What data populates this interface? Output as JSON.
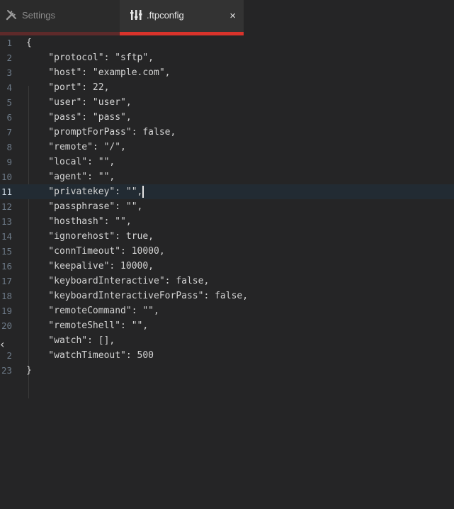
{
  "tabs": [
    {
      "label": "Settings",
      "icon": "tools-icon",
      "active": false
    },
    {
      "label": ".ftpconfig",
      "icon": "sliders-icon",
      "active": true,
      "close": "×"
    }
  ],
  "editor": {
    "current_line": 11,
    "lines": [
      {
        "num": "1",
        "text": "{"
      },
      {
        "num": "2",
        "text": "    \"protocol\": \"sftp\","
      },
      {
        "num": "3",
        "text": "    \"host\": \"example.com\","
      },
      {
        "num": "4",
        "text": "    \"port\": 22,"
      },
      {
        "num": "5",
        "text": "    \"user\": \"user\","
      },
      {
        "num": "6",
        "text": "    \"pass\": \"pass\","
      },
      {
        "num": "7",
        "text": "    \"promptForPass\": false,"
      },
      {
        "num": "8",
        "text": "    \"remote\": \"/\","
      },
      {
        "num": "9",
        "text": "    \"local\": \"\","
      },
      {
        "num": "10",
        "text": "    \"agent\": \"\","
      },
      {
        "num": "11",
        "text": "    \"privatekey\": \"\","
      },
      {
        "num": "12",
        "text": "    \"passphrase\": \"\","
      },
      {
        "num": "13",
        "text": "    \"hosthash\": \"\","
      },
      {
        "num": "14",
        "text": "    \"ignorehost\": true,"
      },
      {
        "num": "15",
        "text": "    \"connTimeout\": 10000,"
      },
      {
        "num": "16",
        "text": "    \"keepalive\": 10000,"
      },
      {
        "num": "17",
        "text": "    \"keyboardInteractive\": false,"
      },
      {
        "num": "18",
        "text": "    \"keyboardInteractiveForPass\": false,"
      },
      {
        "num": "19",
        "text": "    \"remoteCommand\": \"\","
      },
      {
        "num": "20",
        "text": "    \"remoteShell\": \"\","
      },
      {
        "num": "",
        "text": "    \"watch\": [],"
      },
      {
        "num": "2",
        "text": "    \"watchTimeout\": 500"
      },
      {
        "num": "23",
        "text": "}"
      }
    ]
  },
  "colors": {
    "active_tab_underline": "#d9332b",
    "inactive_tab_underline": "#5e2a2a",
    "current_line_bg": "#222b33"
  }
}
